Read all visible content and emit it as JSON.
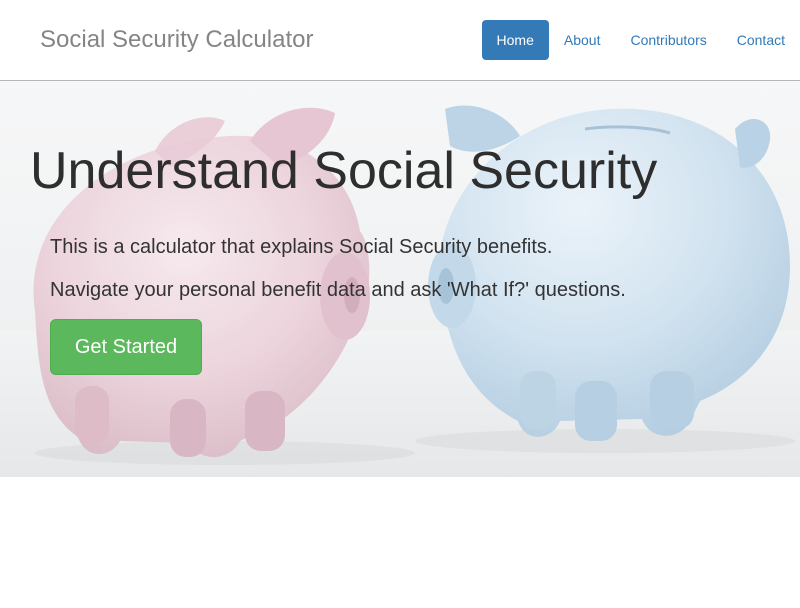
{
  "navbar": {
    "brand": "Social Security Calculator",
    "items": [
      {
        "label": "Home",
        "active": true
      },
      {
        "label": "About",
        "active": false
      },
      {
        "label": "Contributors",
        "active": false
      },
      {
        "label": "Contact",
        "active": false
      }
    ]
  },
  "hero": {
    "background_image": "piggy-banks-pink-and-blue",
    "title": "Understand Social Security",
    "line1": "This is a calculator that explains Social Security benefits.",
    "line2": "Navigate your personal benefit data and ask 'What If?' questions.",
    "cta_label": "Get Started"
  },
  "colors": {
    "primary": "#337ab7",
    "success": "#5cb85c",
    "brand_text": "#858585",
    "title_text": "#2e2e2e"
  }
}
